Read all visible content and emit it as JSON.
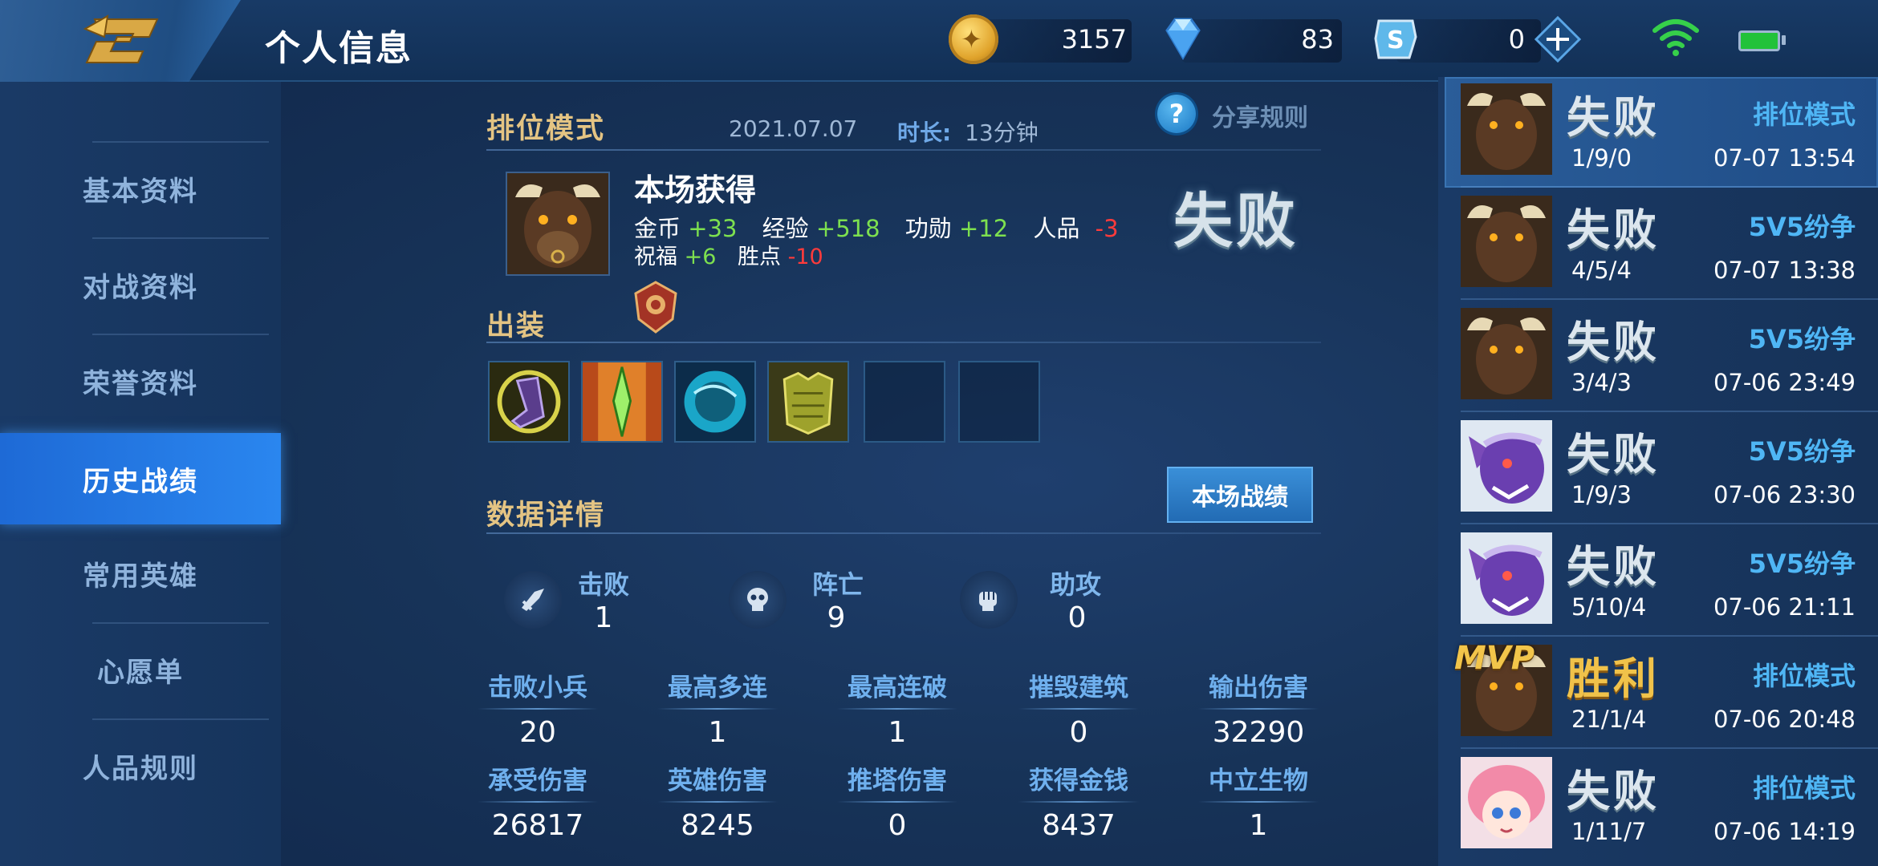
{
  "header": {
    "title": "个人信息",
    "gold": "3157",
    "diamonds": "83",
    "tickets": "0"
  },
  "nav": {
    "items": [
      {
        "label": "基本资料"
      },
      {
        "label": "对战资料"
      },
      {
        "label": "荣誉资料"
      },
      {
        "label": "历史战绩"
      },
      {
        "label": "常用英雄"
      },
      {
        "label": "心愿单"
      },
      {
        "label": "人品规则"
      }
    ],
    "active_index": 3
  },
  "match_detail": {
    "mode": "排位模式",
    "date": "2021.07.07",
    "duration_label": "时长:",
    "duration": "13分钟",
    "share_rules": "分享规则",
    "result": "失败",
    "rewards": {
      "title": "本场获得",
      "gold_label": "金币",
      "gold": "+33",
      "exp_label": "经验",
      "exp": "+518",
      "merit_label": "功勋",
      "merit": "+12",
      "renpin_label": "人品",
      "renpin": "-3",
      "blessing_label": "祝福",
      "blessing": "+6",
      "points_label": "胜点",
      "points": "-10"
    },
    "equipment_title": "出装",
    "data_title": "数据详情",
    "record_button": "本场战绩",
    "kda": {
      "kills_label": "击败",
      "kills": "1",
      "deaths_label": "阵亡",
      "deaths": "9",
      "assists_label": "助攻",
      "assists": "0"
    },
    "stats_row1": [
      {
        "label": "击败小兵",
        "value": "20"
      },
      {
        "label": "最高多连",
        "value": "1"
      },
      {
        "label": "最高连破",
        "value": "1"
      },
      {
        "label": "摧毁建筑",
        "value": "0"
      },
      {
        "label": "输出伤害",
        "value": "32290"
      }
    ],
    "stats_row2": [
      {
        "label": "承受伤害",
        "value": "26817"
      },
      {
        "label": "英雄伤害",
        "value": "8245"
      },
      {
        "label": "推塔伤害",
        "value": "0"
      },
      {
        "label": "获得金钱",
        "value": "8437"
      },
      {
        "label": "中立生物",
        "value": "1"
      }
    ]
  },
  "history": [
    {
      "result": "失败",
      "mode": "排位模式",
      "kda": "1/9/0",
      "time": "07-07 13:54"
    },
    {
      "result": "失败",
      "mode": "5V5纷争",
      "kda": "4/5/4",
      "time": "07-07 13:38"
    },
    {
      "result": "失败",
      "mode": "5V5纷争",
      "kda": "3/4/3",
      "time": "07-06 23:49"
    },
    {
      "result": "失败",
      "mode": "5V5纷争",
      "kda": "1/9/3",
      "time": "07-06 23:30"
    },
    {
      "result": "失败",
      "mode": "5V5纷争",
      "kda": "5/10/4",
      "time": "07-06 21:11"
    },
    {
      "result": "胜利",
      "mode": "排位模式",
      "kda": "21/1/4",
      "time": "07-06 20:48",
      "badge": "MVP"
    },
    {
      "result": "失败",
      "mode": "排位模式",
      "kda": "1/11/7",
      "time": "07-06 14:19"
    }
  ],
  "colors": {
    "gain": "#7de04f",
    "loss": "#ff3b3b",
    "section_title": "#e4c483",
    "mode_text": "#4fb6f5"
  },
  "icons": [
    "back-icon",
    "gold-coin-icon",
    "diamond-icon",
    "ticket-icon",
    "plus-icon",
    "wifi-icon",
    "battery-icon",
    "help-icon",
    "rank-badge-icon",
    "kill-icon",
    "death-skull-icon",
    "assist-fist-icon"
  ]
}
